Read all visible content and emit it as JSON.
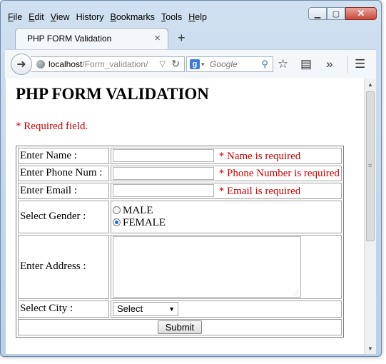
{
  "menu": [
    {
      "label": "File",
      "ul": "F",
      "rest": "ile"
    },
    {
      "label": "Edit",
      "ul": "E",
      "rest": "dit"
    },
    {
      "label": "View",
      "ul": "V",
      "rest": "iew"
    },
    {
      "label": "History",
      "ul": "",
      "rest": "History"
    },
    {
      "label": "Bookmarks",
      "ul": "B",
      "rest": "ookmarks"
    },
    {
      "label": "Tools",
      "ul": "T",
      "rest": "ools"
    },
    {
      "label": "Help",
      "ul": "H",
      "rest": "elp"
    }
  ],
  "tab": {
    "title": "PHP FORM Validation",
    "close": "×",
    "new": "+"
  },
  "nav": {
    "url_host": "localhost",
    "url_path": "/Form_validation/",
    "search_placeholder": "Google",
    "search_engine_letter": "g"
  },
  "page": {
    "title": "PHP FORM VALIDATION",
    "required_note": "* Required field."
  },
  "form": {
    "name_label": "Enter Name :",
    "name_error": "* Name is required",
    "phone_label": "Enter Phone Num :",
    "phone_error": "* Phone Number is required",
    "email_label": "Enter Email :",
    "email_error": "* Email is required",
    "gender_label": "Select Gender :",
    "gender_options": [
      {
        "label": "MALE",
        "checked": false
      },
      {
        "label": "FEMALE",
        "checked": true
      }
    ],
    "address_label": "Enter Address :",
    "city_label": "Select City :",
    "city_selected": "Select",
    "submit_label": "Submit"
  }
}
